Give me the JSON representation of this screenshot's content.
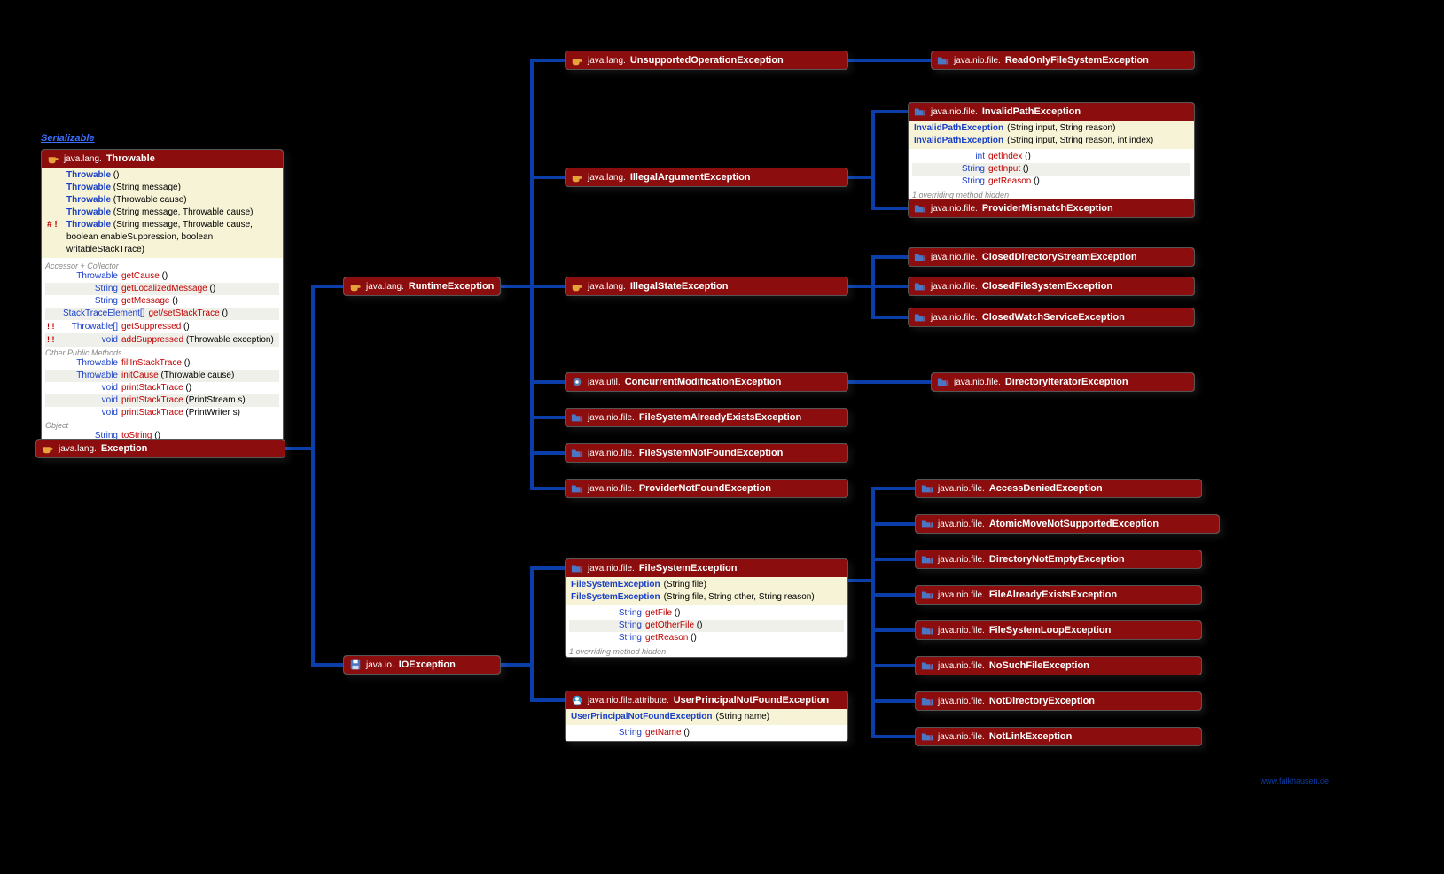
{
  "serializable": "Serializable",
  "credit": "www.falkhausen.de",
  "throwable": {
    "pkg": "java.lang.",
    "cls": "Throwable",
    "ctors": [
      [
        "",
        "Throwable",
        " ()"
      ],
      [
        "",
        "Throwable",
        " (String message)"
      ],
      [
        "",
        "Throwable",
        " (Throwable cause)"
      ],
      [
        "",
        "Throwable",
        " (String message, Throwable cause)"
      ],
      [
        "# !",
        "Throwable",
        " (String message, Throwable cause,"
      ],
      [
        "",
        "",
        "          boolean enableSuppression, boolean writableStackTrace)"
      ]
    ],
    "sec1": "Accessor + Collector",
    "acc": [
      [
        "Throwable",
        "getCause",
        " ()"
      ],
      [
        "String",
        "getLocalizedMessage",
        " ()"
      ],
      [
        "String",
        "getMessage",
        " ()"
      ],
      [
        "StackTraceElement[]",
        "get/setStackTrace",
        " ()"
      ],
      [
        "Throwable[]",
        "getSuppressed",
        " ()"
      ],
      [
        "void",
        "addSuppressed",
        " (Throwable exception)"
      ]
    ],
    "accMod": [
      "",
      "",
      "",
      "",
      "! !",
      "! !"
    ],
    "sec2": "Other Public Methods",
    "other": [
      [
        "Throwable",
        "fillInStackTrace",
        " ()"
      ],
      [
        "Throwable",
        "initCause",
        " (Throwable cause)"
      ],
      [
        "void",
        "printStackTrace",
        " ()"
      ],
      [
        "void",
        "printStackTrace",
        " (PrintStream s)"
      ],
      [
        "void",
        "printStackTrace",
        " (PrintWriter s)"
      ]
    ],
    "sec3": "Object",
    "obj": [
      [
        "String",
        "toString",
        " ()"
      ]
    ]
  },
  "exception": {
    "pkg": "java.lang.",
    "cls": "Exception"
  },
  "runtime": {
    "pkg": "java.lang.",
    "cls": "RuntimeException"
  },
  "io": {
    "pkg": "java.io.",
    "cls": "IOException"
  },
  "unsupported": {
    "pkg": "java.lang.",
    "cls": "UnsupportedOperationException"
  },
  "illegalarg": {
    "pkg": "java.lang.",
    "cls": "IllegalArgumentException"
  },
  "illegalstate": {
    "pkg": "java.lang.",
    "cls": "IllegalStateException"
  },
  "concurrent": {
    "pkg": "java.util.",
    "cls": "ConcurrentModificationException"
  },
  "fsalready": {
    "pkg": "java.nio.file.",
    "cls": "FileSystemAlreadyExistsException"
  },
  "fsnotfound": {
    "pkg": "java.nio.file.",
    "cls": "FileSystemNotFoundException"
  },
  "providernf": {
    "pkg": "java.nio.file.",
    "cls": "ProviderNotFoundException"
  },
  "readonly": {
    "pkg": "java.nio.file.",
    "cls": "ReadOnlyFileSystemException"
  },
  "invalidpath": {
    "pkg": "java.nio.file.",
    "cls": "InvalidPathException",
    "ctors": [
      [
        "InvalidPathException",
        " (String input, String reason)"
      ],
      [
        "InvalidPathException",
        " (String input, String reason, int index)"
      ]
    ],
    "methods": [
      [
        "int",
        "getIndex",
        " ()"
      ],
      [
        "String",
        "getInput",
        " ()"
      ],
      [
        "String",
        "getReason",
        " ()"
      ]
    ],
    "hidden": "1 overriding method hidden"
  },
  "providermm": {
    "pkg": "java.nio.file.",
    "cls": "ProviderMismatchException"
  },
  "closeddir": {
    "pkg": "java.nio.file.",
    "cls": "ClosedDirectoryStreamException"
  },
  "closedfs": {
    "pkg": "java.nio.file.",
    "cls": "ClosedFileSystemException"
  },
  "closedws": {
    "pkg": "java.nio.file.",
    "cls": "ClosedWatchServiceException"
  },
  "diriter": {
    "pkg": "java.nio.file.",
    "cls": "DirectoryIteratorException"
  },
  "fse": {
    "pkg": "java.nio.file.",
    "cls": "FileSystemException",
    "ctors": [
      [
        "FileSystemException",
        " (String file)"
      ],
      [
        "FileSystemException",
        " (String file, String other, String reason)"
      ]
    ],
    "methods": [
      [
        "String",
        "getFile",
        " ()"
      ],
      [
        "String",
        "getOtherFile",
        " ()"
      ],
      [
        "String",
        "getReason",
        " ()"
      ]
    ],
    "hidden": "1 overriding method hidden"
  },
  "upnfe": {
    "pkg": "java.nio.file.attribute.",
    "cls": "UserPrincipalNotFoundException",
    "ctor": [
      "UserPrincipalNotFoundException",
      " (String name)"
    ],
    "methods": [
      [
        "String",
        "getName",
        " ()"
      ]
    ]
  },
  "accessdenied": {
    "pkg": "java.nio.file.",
    "cls": "AccessDeniedException"
  },
  "atomic": {
    "pkg": "java.nio.file.",
    "cls": "AtomicMoveNotSupportedException"
  },
  "dirnotempty": {
    "pkg": "java.nio.file.",
    "cls": "DirectoryNotEmptyException"
  },
  "filealready": {
    "pkg": "java.nio.file.",
    "cls": "FileAlreadyExistsException"
  },
  "fsloop": {
    "pkg": "java.nio.file.",
    "cls": "FileSystemLoopException"
  },
  "nosuchfile": {
    "pkg": "java.nio.file.",
    "cls": "NoSuchFileException"
  },
  "notdir": {
    "pkg": "java.nio.file.",
    "cls": "NotDirectoryException"
  },
  "notlink": {
    "pkg": "java.nio.file.",
    "cls": "NotLinkException"
  }
}
